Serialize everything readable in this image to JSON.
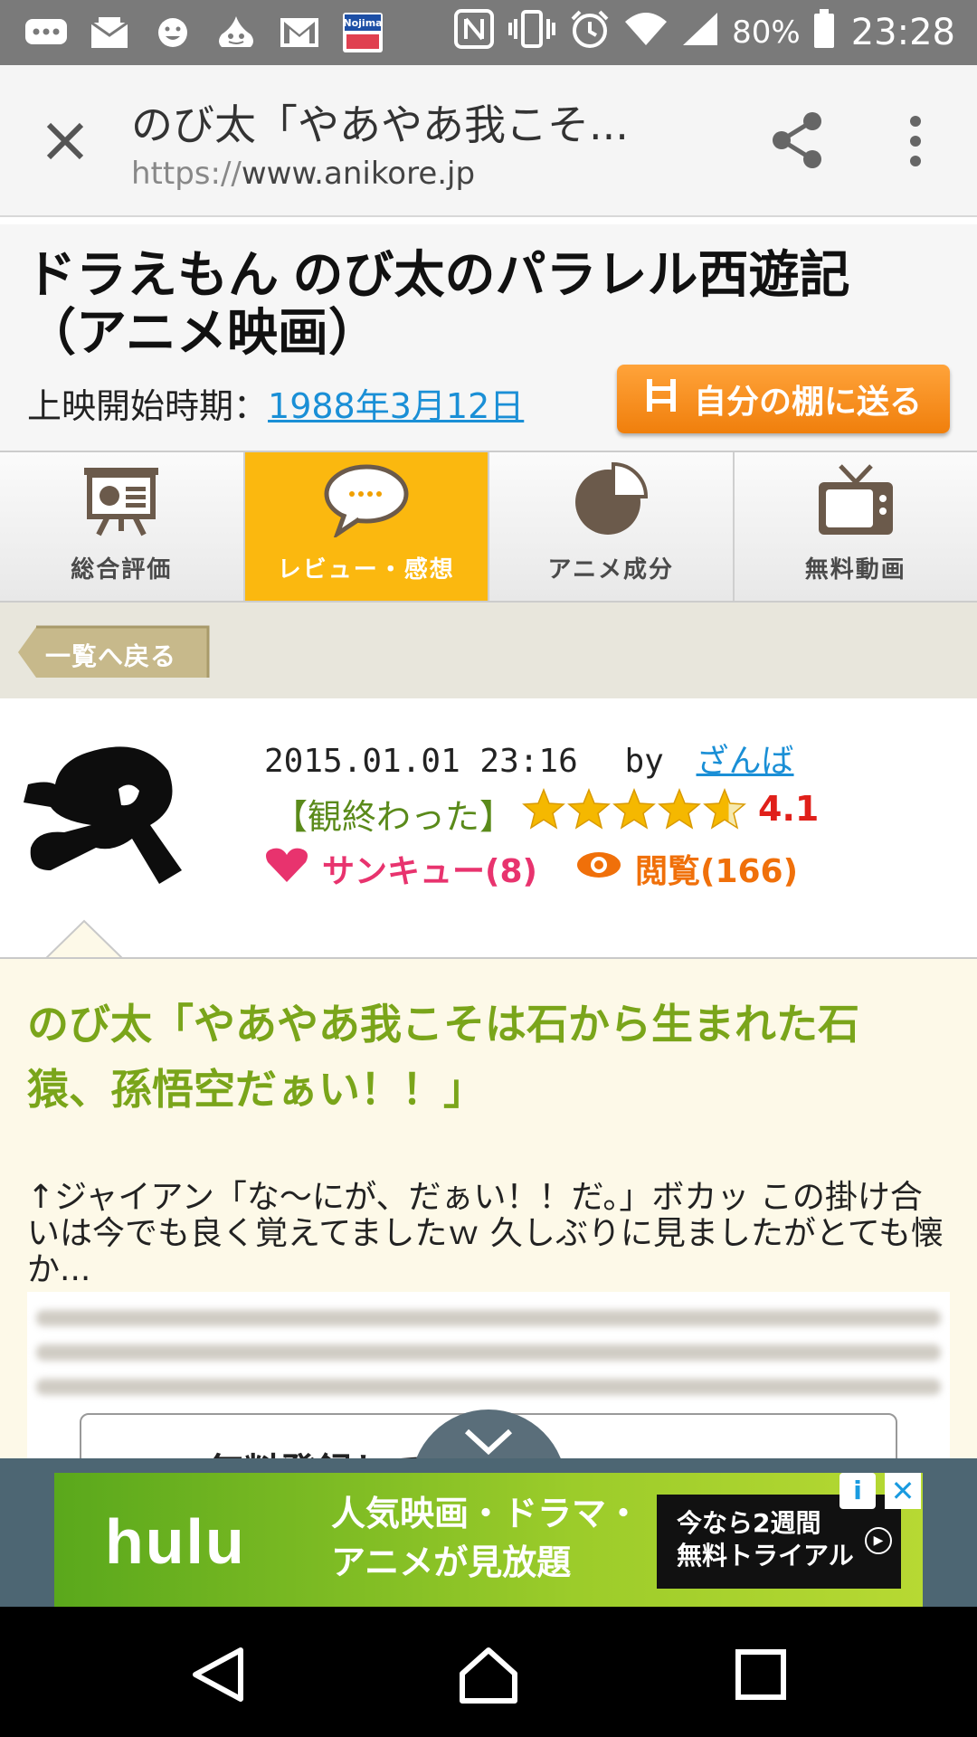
{
  "status_bar": {
    "battery_percent": "80%",
    "time": "23:28",
    "notification_icons": [
      "chat-icon",
      "mail-icon",
      "emoji-icon",
      "slime-icon",
      "gmail-icon",
      "nojima-icon"
    ],
    "nojima_label": "Nojima"
  },
  "browser": {
    "page_title": "のび太「やあやあ我こそ...",
    "url_scheme": "https://",
    "url_host": "www.anikore.jp"
  },
  "page": {
    "title": "ドラえもん のび太のパラレル西遊記（アニメ映画）",
    "release_label": "上映開始時期：",
    "release_date": "1988年3月12日",
    "send_button": "自分の棚に送る"
  },
  "tabs": [
    {
      "label": "総合評価",
      "icon": "presentation-icon",
      "active": false
    },
    {
      "label": "レビュー・感想",
      "icon": "speech-bubble-icon",
      "active": true
    },
    {
      "label": "アニメ成分",
      "icon": "pie-chart-icon",
      "active": false
    },
    {
      "label": "無料動画",
      "icon": "tv-icon",
      "active": false
    }
  ],
  "back_button": "一覧へ戻る",
  "review": {
    "date": "2015.01.01 23:16",
    "by": "by",
    "author": "ざんば",
    "status": "【観終わった】",
    "rating": "4.1",
    "rating_value": 4.1,
    "thanks": "サンキュー(8)",
    "views": "閲覧(166)",
    "headline": "のび太「やあやあ我こそは石から生まれた石猿、孫悟空だぁい！！」",
    "excerpt": "↑ジャイアン「な〜にが、だぁい！！だ。」ボカッ この掛け合いは今でも良く覚えてましたｗ 久しぶりに見ましたがとても懐か...",
    "cta_partial": "無料登録して"
  },
  "ad": {
    "brand": "hulu",
    "copy_line1": "人気映画・ドラマ・",
    "copy_line2": "アニメが見放題",
    "cta_line1": "今なら2週間",
    "cta_line2": "無料トライアル",
    "info": "i",
    "close": "✕"
  },
  "colors": {
    "accent_orange": "#f0890f",
    "tab_active": "#fbb80f",
    "headline_green": "#7aa51a",
    "link_blue": "#1a8fd6",
    "rating_red": "#e0201a"
  }
}
